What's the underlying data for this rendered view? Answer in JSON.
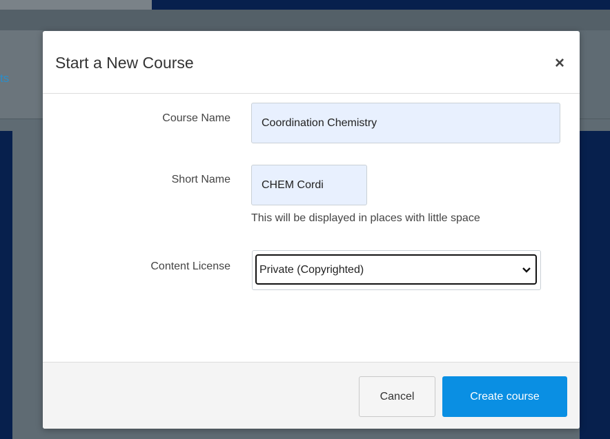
{
  "background": {
    "link_fragment": "ts"
  },
  "modal": {
    "title": "Start a New Course",
    "close_symbol": "×",
    "fields": {
      "course_name": {
        "label": "Course Name",
        "value": "Coordination Chemistry"
      },
      "short_name": {
        "label": "Short Name",
        "value": "CHEM Cordi",
        "help": "This will be displayed in places with little space"
      },
      "content_license": {
        "label": "Content License",
        "selected": "Private (Copyrighted)"
      }
    },
    "footer": {
      "cancel_label": "Cancel",
      "create_label": "Create course"
    }
  },
  "colors": {
    "primary_button": "#0a8fe3",
    "input_autofill": "#e8f0fe",
    "navy": "#07204d"
  },
  "icons": [
    "close-icon",
    "chevron-down-icon"
  ]
}
